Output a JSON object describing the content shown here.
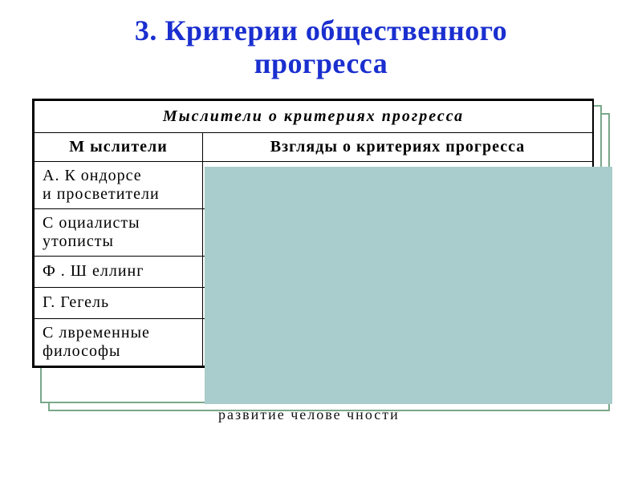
{
  "title_line1": "3. Критерии общественного",
  "title_line2": "прогресса",
  "table": {
    "caption": "Мыслители   о  критериях   прогресса",
    "col_left": "М ыслители",
    "col_right": "Взгляды о критериях прогресса",
    "rows": [
      {
        "thinker_l1": "А. К ондорсе",
        "thinker_l2": "и просветители",
        "views": ""
      },
      {
        "thinker_l1": "С оциалисты",
        "thinker_l2": "утописты",
        "views": ""
      },
      {
        "thinker_l1": "Ф . Ш еллинг",
        "thinker_l2": "",
        "views": ""
      },
      {
        "thinker_l1": "Г. Гегель",
        "thinker_l2": "",
        "views": ""
      },
      {
        "thinker_l1": "С лвременные",
        "thinker_l2": "философы",
        "views": ""
      }
    ]
  },
  "footer_fragment": "развитие  челове  чности",
  "chart_data": {
    "type": "table",
    "title": "Мыслители о критериях прогресса",
    "columns": [
      "Мыслители",
      "Взгляды о критериях прогресса"
    ],
    "rows": [
      [
        "А. Кондорсе и просветители",
        ""
      ],
      [
        "Социалисты утописты",
        ""
      ],
      [
        "Ф. Шеллинг",
        ""
      ],
      [
        "Г. Гегель",
        ""
      ],
      [
        "Слвременные философы",
        ""
      ]
    ]
  }
}
